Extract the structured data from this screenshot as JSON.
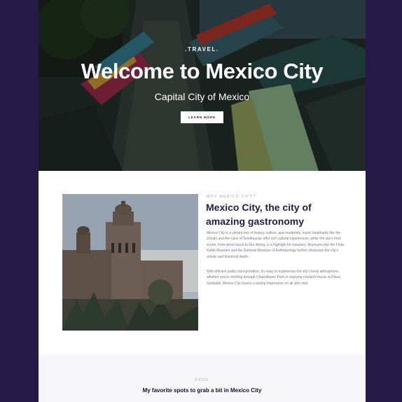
{
  "colors": {
    "background": "#261b47",
    "panel": "#ffffff",
    "heading": "#241c45",
    "muted": "#7a7687",
    "section_alt": "#f6f6f8"
  },
  "hero": {
    "eyebrow": ".TRAVEL.",
    "title": "Welcome to Mexico City",
    "subtitle": "Capital City of Mexico",
    "button_label": "LEARN MORE",
    "image": "colorful-boats-canal-photo"
  },
  "about": {
    "eyebrow": "WHY MEXICO CITY?",
    "title": "Mexico City, the city of amazing gastronomy",
    "paragraph1": "Mexico City is a vibrant mix of history, culture, and modernity. Iconic landmarks like the Zócalo and the ruins of Teotihuacan offer rich cultural experiences, while the city's food scene, from street tacos to fine dining, is a highlight for travelers. Museums like the Frida Kahlo Museum and the National Museum of Anthropology further showcase the city's artistic and historical depth.",
    "paragraph2": "With efficient public transportation, it's easy to experience the city's lively atmosphere, whether you're strolling through Chapultepec Park or enjoying mariachi music at Plaza Garibaldi. Mexico City leaves a lasting impression on all who visit.",
    "image": "cathedral-photo"
  },
  "food": {
    "eyebrow": "FOOD",
    "title": "My favorite spots to grab a bit in Mexico City"
  }
}
